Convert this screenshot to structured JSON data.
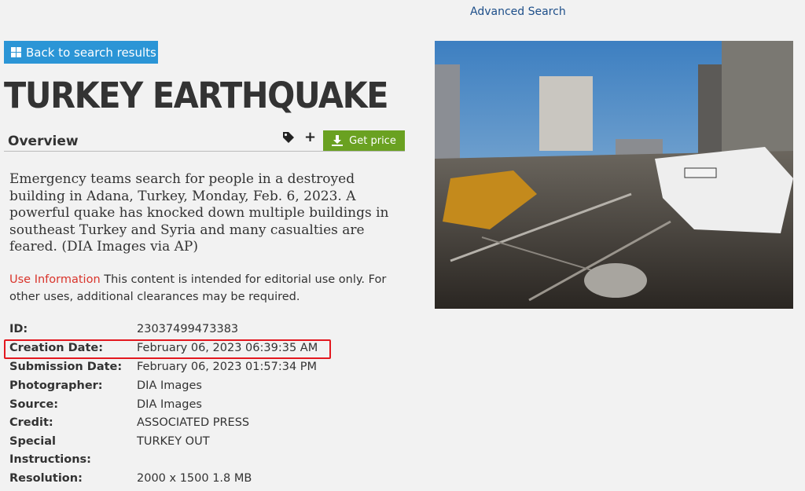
{
  "header": {
    "advanced_search": "Advanced Search"
  },
  "back_button": {
    "label": "Back to search results"
  },
  "title": "TURKEY EARTHQUAKE",
  "tabs": {
    "overview": "Overview"
  },
  "actions": {
    "get_price": "Get price",
    "tag_icon": "tag-icon",
    "plus_icon": "+",
    "download_icon": "download-icon"
  },
  "description": "Emergency teams search for people in a destroyed building in Adana, Turkey, Monday, Feb. 6, 2023. A powerful quake has knocked down multiple buildings in southeast Turkey and Syria and many casualties are feared. (DIA Images via AP)",
  "use_info": {
    "label": "Use Information",
    "text": " This content is intended for editorial use only. For other uses, additional clearances may be required."
  },
  "metadata": [
    {
      "key": "ID:",
      "value": "23037499473383"
    },
    {
      "key": "Creation Date:",
      "value": "February 06, 2023 06:39:35 AM"
    },
    {
      "key": "Submission Date:",
      "value": "February 06, 2023 01:57:34 PM"
    },
    {
      "key": "Photographer:",
      "value": "DIA Images"
    },
    {
      "key": "Source:",
      "value": "DIA Images"
    },
    {
      "key": "Credit:",
      "value": "ASSOCIATED PRESS"
    },
    {
      "key": "Special",
      "value": "TURKEY OUT"
    },
    {
      "key": "Instructions:",
      "value": ""
    },
    {
      "key": "Resolution:",
      "value": "2000 x 1500 1.8 MB"
    }
  ],
  "colors": {
    "accent_blue": "#2b95d6",
    "price_green": "#6aa121",
    "highlight_red": "#e3181f",
    "use_info_red": "#d9342b"
  }
}
